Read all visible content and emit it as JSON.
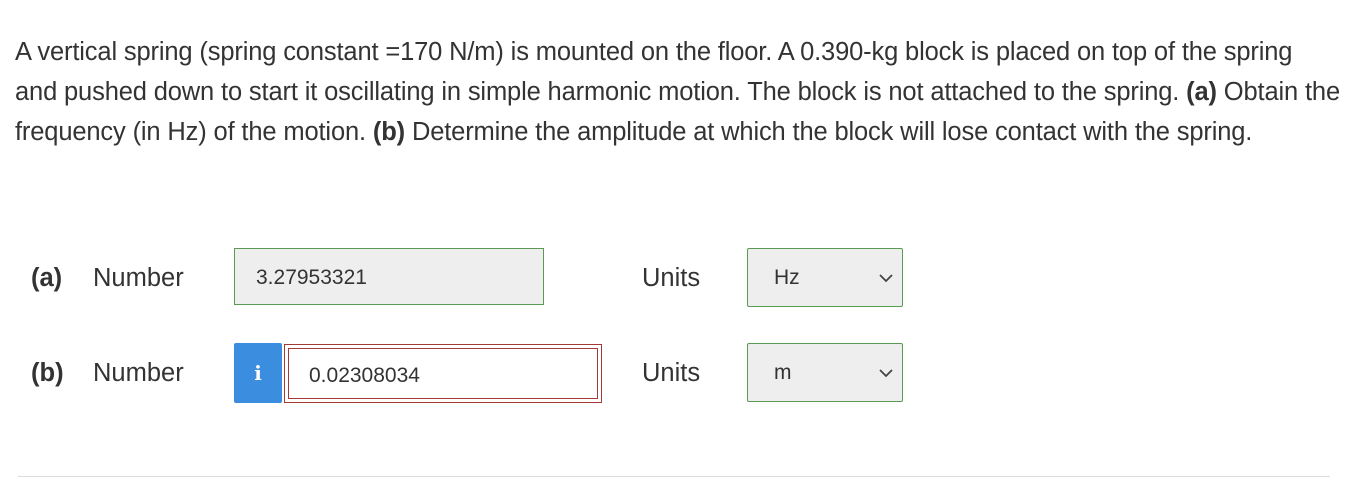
{
  "question": {
    "text_1": "A vertical spring (spring constant =170 N/m) is mounted on the floor. A 0.390-kg block is placed on top of the spring and pushed down to start it oscillating in simple harmonic motion. The block is not attached to the spring. ",
    "part_a_marker": "(a)",
    "text_2": " Obtain the frequency (in Hz) of the motion. ",
    "part_b_marker": "(b)",
    "text_3": " Determine the amplitude at which the block will lose contact with the spring."
  },
  "part_a": {
    "label": "(a)",
    "number_label": "Number",
    "value": "3.27953321",
    "units_label": "Units",
    "unit_selected": "Hz",
    "status": "correct"
  },
  "part_b": {
    "label": "(b)",
    "number_label": "Number",
    "info_icon": "i",
    "value": "0.02308034",
    "units_label": "Units",
    "unit_selected": "m",
    "status": "incorrect"
  },
  "colors": {
    "correct_border": "#5b9a52",
    "incorrect_border": "#a23a3a",
    "info_button": "#3b8de0",
    "text": "#333333"
  }
}
